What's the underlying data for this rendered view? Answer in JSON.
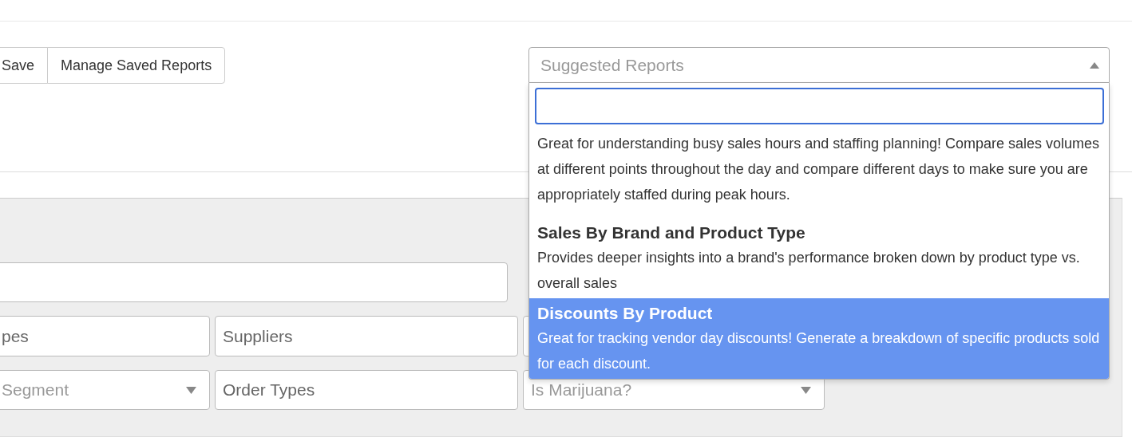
{
  "toolbar": {
    "buttons": [
      "Save",
      "Manage Saved Reports"
    ]
  },
  "suggested_reports": {
    "placeholder": "Suggested Reports",
    "expanded": true,
    "items": [
      {
        "description": "Great for understanding busy sales hours and staffing planning! Compare sales volumes at different points throughout the day and compare different days to make sure you are appropriately staffed during peak hours.",
        "selected": false
      },
      {
        "title": "Sales By Brand and Product Type",
        "description": "Provides deeper insights into a brand's performance broken down by product type vs. overall sales",
        "selected": false
      },
      {
        "title": "Discounts By Product",
        "description": "Great for tracking vendor day discounts! Generate a breakdown of specific products sold for each discount.",
        "selected": true
      }
    ]
  },
  "filters": {
    "rows": [
      [
        {
          "kind": "text"
        }
      ],
      [
        {
          "kind": "text",
          "placeholder": "pes"
        },
        {
          "kind": "text",
          "placeholder": "Suppliers"
        },
        {
          "kind": "text"
        }
      ],
      [
        {
          "kind": "select",
          "placeholder": "Segment"
        },
        {
          "kind": "text",
          "placeholder": "Order Types"
        },
        {
          "kind": "select",
          "placeholder": "Is Marijuana?"
        }
      ]
    ]
  }
}
